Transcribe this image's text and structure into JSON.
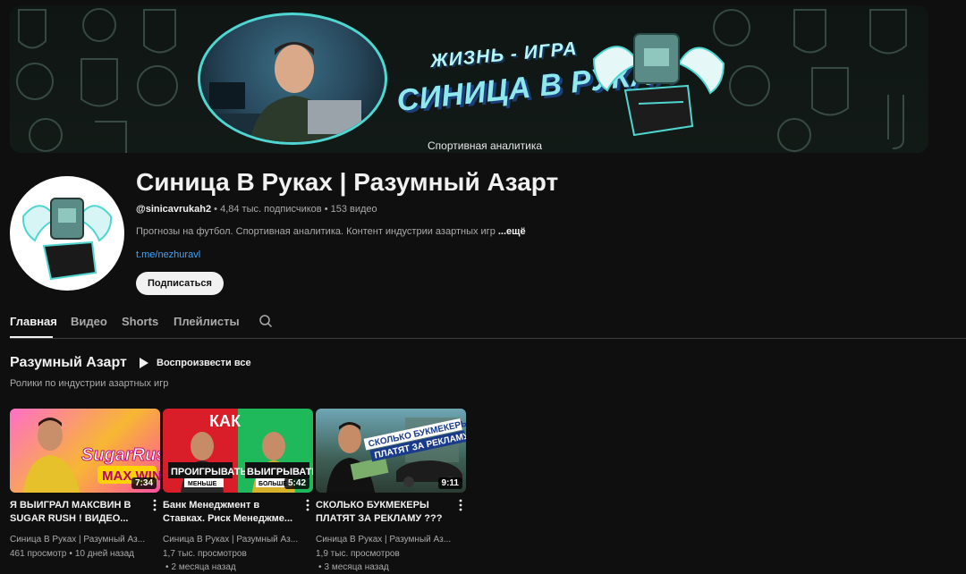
{
  "banner": {
    "title_line1": "ЖИЗНЬ - ИГРА",
    "title_line2": "СИНИЦА В РУКАХ",
    "subtitle": "Спортивная аналитика"
  },
  "channel": {
    "name": "Синица В Руках | Разумный Азарт",
    "handle": "@sinicavrukah2",
    "subscribers": "4,84 тыс. подписчиков",
    "videos_count": "153 видео",
    "description": "Прогнозы на футбол. Спортивная аналитика. Контент индустрии азартных игр",
    "more_label": "...ещё",
    "link": "t.me/nezhuravl",
    "subscribe_label": "Подписаться",
    "meta_separator": "•"
  },
  "tabs": [
    {
      "label": "Главная"
    },
    {
      "label": "Видео"
    },
    {
      "label": "Shorts"
    },
    {
      "label": "Плейлисты"
    }
  ],
  "section": {
    "title": "Разумный Азарт",
    "play_all_label": "Воспроизвести все",
    "subtitle": "Ролики по индустрии азартных игр"
  },
  "videos": [
    {
      "title": "Я ВЫИГРАЛ МАКСВИН В SUGAR RUSH ! ВИДЕО...",
      "duration": "7:34",
      "channel": "Синица В Руках | Разумный Аз...",
      "views": "461 просмотр",
      "date": "10 дней назад",
      "thumb_text1": "SugarRush",
      "thumb_text2": "MAX WIN"
    },
    {
      "title": "Банк Менеджмент в Ставках. Риск Менеджме...",
      "duration": "5:42",
      "channel": "Синица В Руках | Разумный Аз...",
      "views": "1,7 тыс. просмотров",
      "date": "2 месяца назад",
      "thumb_text1": "КАК",
      "thumb_text2": "ПРОИГРЫВАТЬ",
      "thumb_text3": "ВЫИГРЫВАТЬ",
      "thumb_text4": "МЕНЬШЕ",
      "thumb_text5": "БОЛЬШЕ"
    },
    {
      "title": "СКОЛЬКО БУКМЕКЕРЫ ПЛАТЯТ ЗА РЕКЛАМУ ???",
      "duration": "9:11",
      "channel": "Синица В Руках | Разумный Аз...",
      "views": "1,9 тыс. просмотров",
      "date": "3 месяца назад",
      "thumb_text1": "СКОЛЬКО БУКМЕКЕРЫ",
      "thumb_text2": "ПЛАТЯТ ЗА РЕКЛАМУ"
    }
  ],
  "colors": {
    "background": "#0f0f0f",
    "accent_link": "#3ea6ff",
    "banner_teal": "#4fd6d0"
  }
}
